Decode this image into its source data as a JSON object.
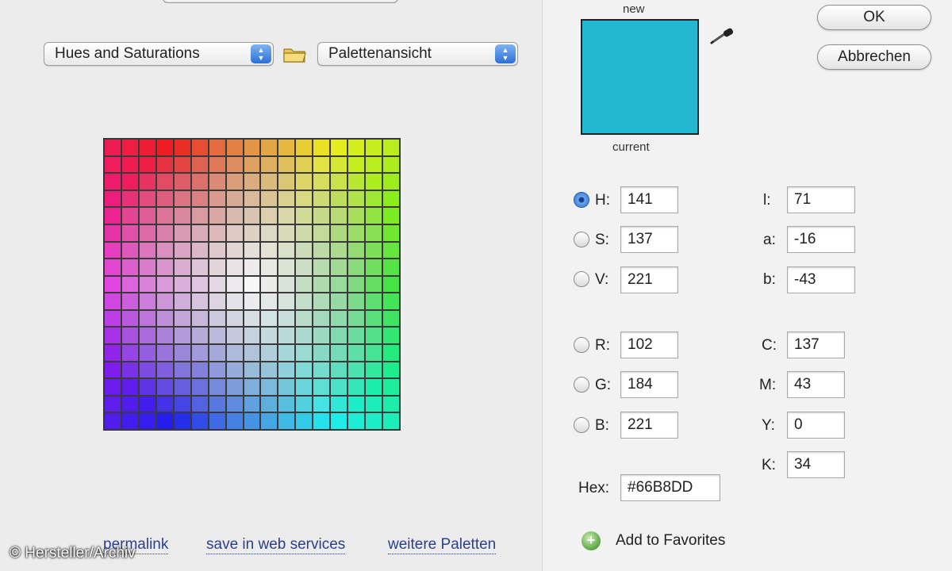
{
  "palette_popup": {
    "label": "Hues and Saturations",
    "stepper_icon": "updown-arrows"
  },
  "view_popup": {
    "label": "Palettenansicht",
    "stepper_icon": "updown-arrows"
  },
  "swatch": {
    "new_label": "new",
    "current_label": "current",
    "color": "#22B8D2"
  },
  "buttons": {
    "ok": "OK",
    "cancel": "Abbrechen"
  },
  "hsv": {
    "h": {
      "label": "H:",
      "value": "141"
    },
    "s": {
      "label": "S:",
      "value": "137"
    },
    "v": {
      "label": "V:",
      "value": "221"
    }
  },
  "lab": {
    "l": {
      "label": "l:",
      "value": "71"
    },
    "a": {
      "label": "a:",
      "value": "-16"
    },
    "b": {
      "label": "b:",
      "value": "-43"
    }
  },
  "rgb": {
    "r": {
      "label": "R:",
      "value": "102"
    },
    "g": {
      "label": "G:",
      "value": "184"
    },
    "b": {
      "label": "B:",
      "value": "221"
    }
  },
  "cmyk": {
    "c": {
      "label": "C:",
      "value": "137"
    },
    "m": {
      "label": "M:",
      "value": "43"
    },
    "y": {
      "label": "Y:",
      "value": "0"
    },
    "k": {
      "label": "K:",
      "value": "34"
    }
  },
  "hex": {
    "label": "Hex:",
    "value": "#66B8DD"
  },
  "favorites": {
    "label": "Add to Favorites",
    "icon": "plus-circle-icon"
  },
  "links": {
    "permalink": "permalink",
    "save": "save in web services",
    "more": "weitere Paletten"
  },
  "watermark": "© Hersteller/Archiv"
}
